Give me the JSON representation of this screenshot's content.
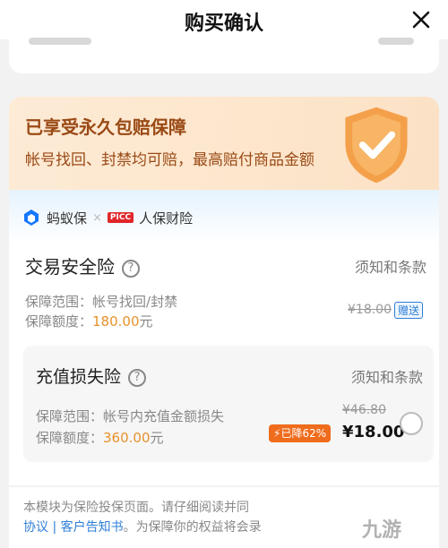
{
  "header": {
    "title": "购买确认"
  },
  "banner": {
    "title": "已享受永久包赔保障",
    "subtitle": "帐号找回、封禁均可赔，最高赔付商品金额"
  },
  "brands": {
    "ant": "蚂蚁保",
    "picc_logo": "PICC",
    "picc": "人保财险"
  },
  "insurance1": {
    "name": "交易安全险",
    "terms": "须知和条款",
    "scope_label": "保障范围：",
    "scope_value": "帐号找回/封禁",
    "amount_label": "保障额度：",
    "amount_value": "180.00",
    "amount_unit": "元",
    "original_price": "¥18.00",
    "tag": "赠送"
  },
  "insurance2": {
    "name": "充值损失险",
    "terms": "须知和条款",
    "scope_label": "保障范围：",
    "scope_value": "帐号内充值金额损失",
    "amount_label": "保障额度：",
    "amount_value": "360.00",
    "amount_unit": "元",
    "original_price": "¥46.80",
    "discount": "已降62%",
    "price": "¥18.00"
  },
  "footer": {
    "line1": "本模块为保险投保页面。请仔细阅读并同",
    "link1": "协议",
    "sep": " | ",
    "link2": "客户告知书",
    "line2_rest": "。为保障你的权益将会录"
  },
  "watermark": "九游",
  "colors": {
    "accent": "#e8912c",
    "banner_text": "#9a4a16",
    "link": "#2f7fd6",
    "discount": "#ef6c1d"
  }
}
